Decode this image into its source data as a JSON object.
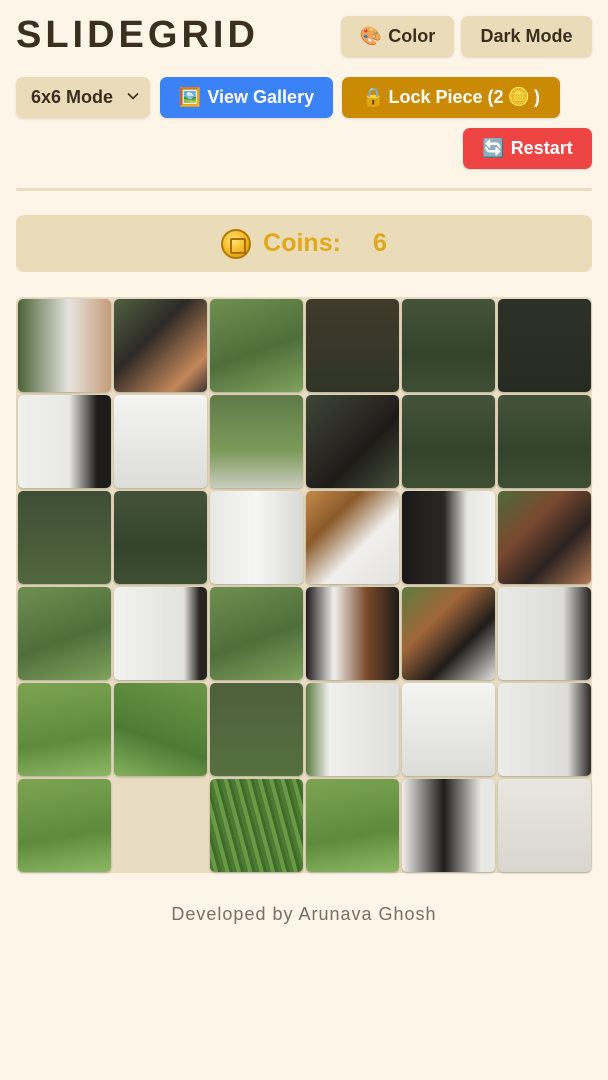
{
  "header": {
    "title": "SLIDEGRID",
    "color_button": "Color",
    "dark_mode_button": "Dark Mode"
  },
  "controls": {
    "mode_select": "6x6 Mode",
    "view_gallery": "View Gallery",
    "lock_piece_prefix": "Lock Piece (2",
    "lock_piece_suffix": ")",
    "restart": "Restart"
  },
  "coins": {
    "label": "Coins:",
    "value": "6"
  },
  "board": {
    "size": 6,
    "empty_tile": {
      "row": 5,
      "col": 1
    }
  },
  "footer": {
    "credit": "Developed by Arunava Ghosh"
  },
  "icons": {
    "color_button_icon": "palette-icon",
    "gallery_button_icon": "framed-picture-icon",
    "lock_button_icon": "lock-icon",
    "lock_cost_icon": "coin-icon",
    "restart_icon": "refresh-icon",
    "coins_icon": "coin-icon",
    "select_icon": "chevron-down-icon"
  },
  "colors": {
    "background": "#fdf5e8",
    "beige_button": "#ebdcb9",
    "gallery_button": "#3b82f6",
    "lock_button": "#ca8a04",
    "restart_button": "#ef4444",
    "coins_text": "#e0a81a"
  }
}
